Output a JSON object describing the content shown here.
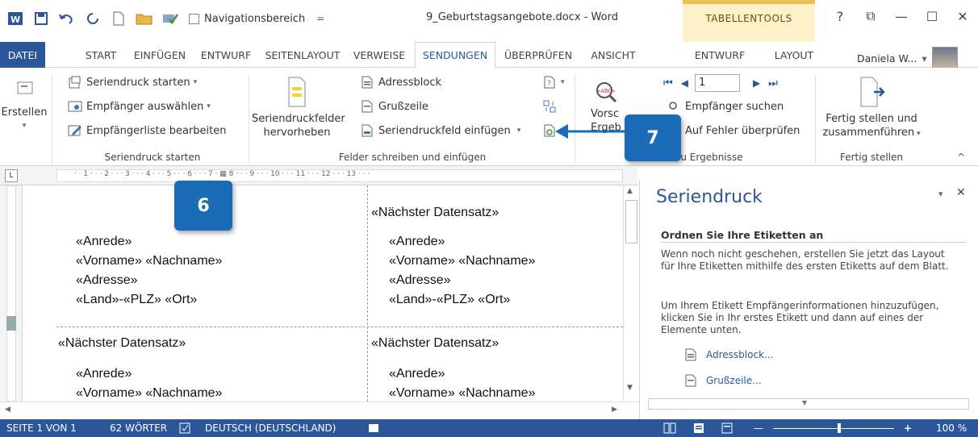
{
  "qat": {
    "nav_label": "Navigationsbereich",
    "nav_arrow": "="
  },
  "window": {
    "title": "9_Geburtstagsangebote.docx - Word"
  },
  "contextual": {
    "label": "TABELLENTOOLS"
  },
  "winctrl": {
    "help": "?",
    "restore": "⧉",
    "minimize": "—",
    "maximize": "☐",
    "close": "✕"
  },
  "tabs": [
    {
      "label": "DATEI"
    },
    {
      "label": "START"
    },
    {
      "label": "EINFÜGEN"
    },
    {
      "label": "ENTWURF"
    },
    {
      "label": "SEITENLAYOUT"
    },
    {
      "label": "VERWEISE"
    },
    {
      "label": "SENDUNGEN"
    },
    {
      "label": "ÜBERPRÜFEN"
    },
    {
      "label": "ANSICHT"
    },
    {
      "label": "ENTWURF"
    },
    {
      "label": "LAYOUT"
    }
  ],
  "user": {
    "name": "Daniela W...",
    "arrow": "▾"
  },
  "ribbon": {
    "erstellen": "Erstellen",
    "g1": {
      "start": "Seriendruck starten",
      "recipients": "Empfänger auswählen",
      "edit": "Empfängerliste bearbeiten",
      "label": "Seriendruck starten"
    },
    "g2": {
      "highlight1": "Seriendruckfelder",
      "highlight2": "hervorheben",
      "address": "Adressblock",
      "greeting": "Grußzeile",
      "insert": "Seriendruckfeld einfügen",
      "label": "Felder schreiben und einfügen"
    },
    "g3": {
      "preview1": "Vorsc",
      "preview2": "Ergeb",
      "record": "1",
      "find": "Empfänger suchen",
      "check": "Auf Fehler überprüfen",
      "label": "au Ergebnisse"
    },
    "g4": {
      "finish1": "Fertig stellen und",
      "finish2": "zusammenführen",
      "label": "Fertig stellen"
    }
  },
  "callouts": {
    "c6": "6",
    "c7": "7"
  },
  "ruler": {
    "text": "· · 1 · · · 2 · · · 3 · · · 4 · · · 5 · · · 6 · · · 7 · ▦ 8 · · · 9 · · · 10 · · · 11 · · · 12 · · · 13 · · ·"
  },
  "document": {
    "next": "«Nächster Datensatz»",
    "salutation": "«Anrede»",
    "name": "«Vorname» «Nachname»",
    "address": "«Adresse»",
    "city": "«Land»-«PLZ» «Ort»"
  },
  "pane": {
    "title": "Seriendruck",
    "heading": "Ordnen Sie Ihre Etiketten an",
    "p1": "Wenn noch nicht geschehen, erstellen Sie jetzt das Layout für Ihre Etiketten mithilfe des ersten Etiketts auf dem Blatt.",
    "p2": "Um Ihrem Etikett Empfängerinformationen hinzuzufügen, klicken Sie in Ihr erstes Etikett und dann auf eines der Elemente unten.",
    "link1": "Adressblock...",
    "link2": "Grußzeile..."
  },
  "status": {
    "page": "SEITE 1 VON 1",
    "words": "62 WÖRTER",
    "lang": "DEUTSCH (DEUTSCHLAND)",
    "zoom": "100 %",
    "zoom_plus": "+",
    "zoom_minus": "—"
  },
  "colors": {
    "accent": "#2b579a",
    "callout": "#1c6bb7",
    "contextual": "#fdf1c9"
  }
}
